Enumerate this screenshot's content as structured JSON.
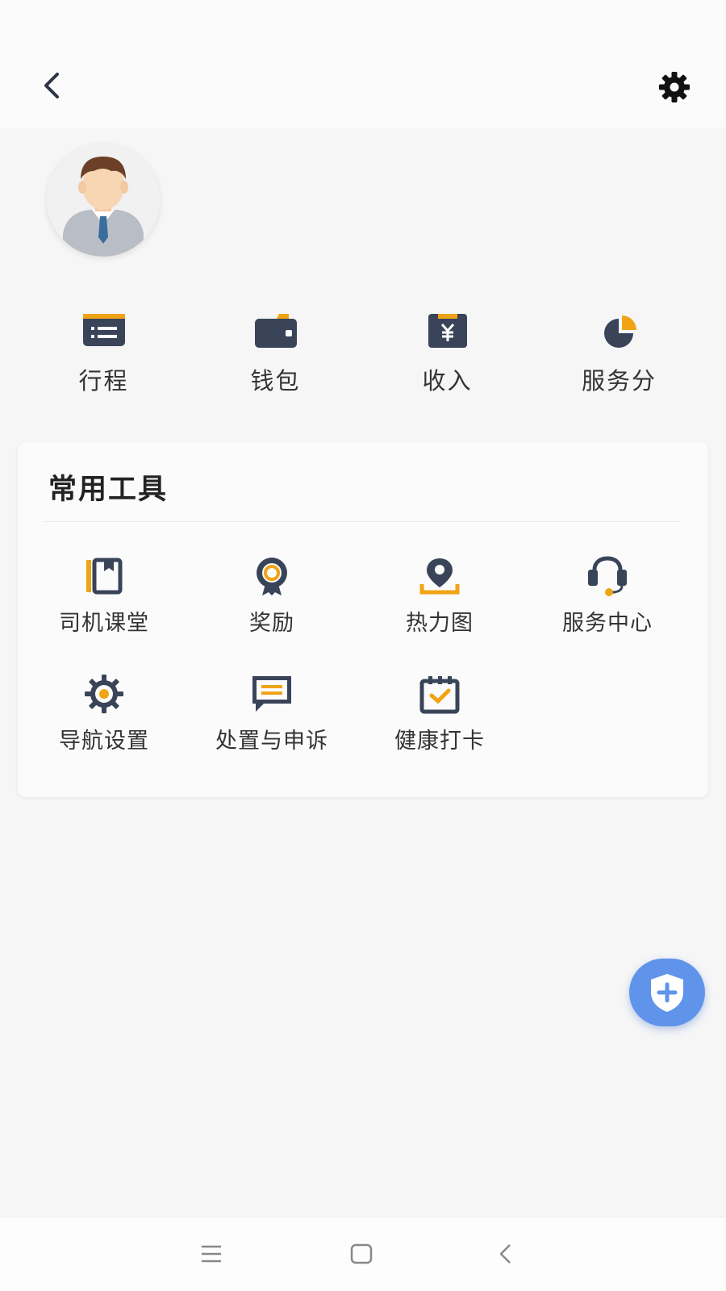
{
  "header": {
    "back_icon": "chevron-left-icon",
    "settings_icon": "gear-icon"
  },
  "profile": {
    "avatar_icon": "driver-avatar"
  },
  "shortcuts": [
    {
      "label": "行程",
      "icon": "trip-card-icon"
    },
    {
      "label": "钱包",
      "icon": "wallet-icon"
    },
    {
      "label": "收入",
      "icon": "income-yuan-icon"
    },
    {
      "label": "服务分",
      "icon": "pie-chart-icon"
    }
  ],
  "tools": {
    "title": "常用工具",
    "items": [
      {
        "label": "司机课堂",
        "icon": "book-icon"
      },
      {
        "label": "奖励",
        "icon": "award-badge-icon"
      },
      {
        "label": "热力图",
        "icon": "map-pin-icon"
      },
      {
        "label": "服务中心",
        "icon": "headset-icon"
      },
      {
        "label": "导航设置",
        "icon": "navigation-gear-icon"
      },
      {
        "label": "处置与申诉",
        "icon": "message-icon"
      },
      {
        "label": "健康打卡",
        "icon": "calendar-check-icon"
      }
    ]
  },
  "fab": {
    "icon": "shield-plus-icon"
  },
  "system_nav": {
    "menu_icon": "menu-icon",
    "home_icon": "home-square-icon",
    "back_icon": "back-triangle-icon"
  },
  "colors": {
    "navy": "#3a4459",
    "accent_orange": "#f0a415",
    "fab_blue": "#5f94ea",
    "background": "#f6f6f7"
  }
}
